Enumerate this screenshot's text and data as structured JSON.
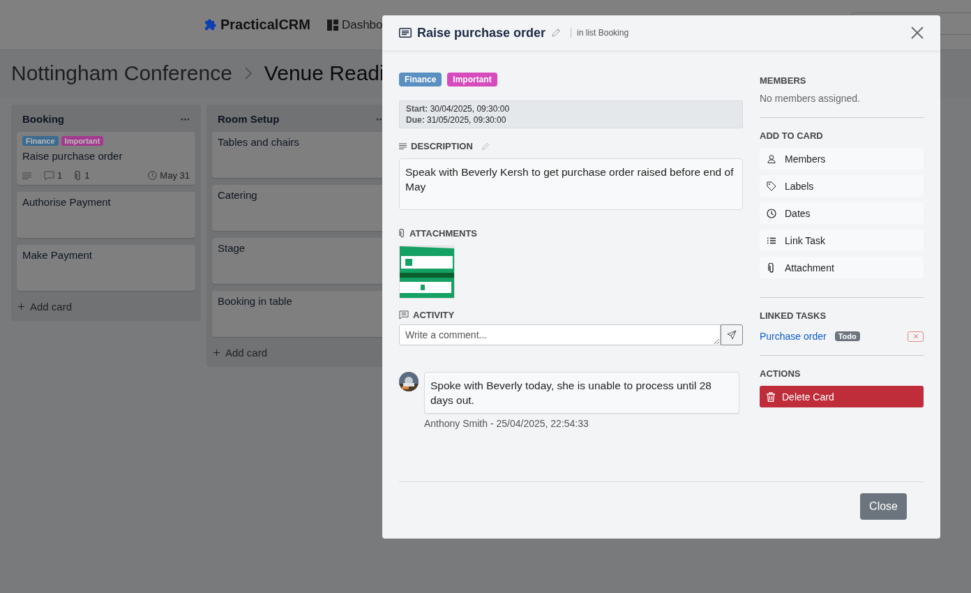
{
  "header": {
    "brand": "PracticalCRM",
    "nav": [
      {
        "label": "Dashbo"
      }
    ]
  },
  "breadcrumb": [
    "Nottingham Conference",
    "Venue Readi"
  ],
  "columns": [
    {
      "title": "Booking",
      "cards": [
        {
          "title": "Raise purchase order",
          "labels": [
            {
              "text": "Finance",
              "color": "#3d6b8f"
            },
            {
              "text": "Important",
              "color": "#a33a8f"
            }
          ],
          "has_description": true,
          "comments": "1",
          "attachments": "1",
          "due": "May 31"
        },
        {
          "title": "Authorise Payment"
        },
        {
          "title": "Make Payment"
        }
      ],
      "add": "Add card"
    },
    {
      "title": "Room Setup",
      "cards": [
        {
          "title": "Tables and chairs"
        },
        {
          "title": "Catering"
        },
        {
          "title": "Stage"
        },
        {
          "title": "Booking in table"
        }
      ],
      "add": "Add card"
    }
  ],
  "modal": {
    "title": "Raise purchase order",
    "list_info": "in list Booking",
    "labels": [
      {
        "text": "Finance",
        "color": "#5a8fc1"
      },
      {
        "text": "Important",
        "color": "#d84bbd"
      }
    ],
    "dates": [
      {
        "label": "Start:",
        "value": "30/04/2025, 09:30:00"
      },
      {
        "label": "Due:",
        "value": "31/05/2025, 09:30:00"
      }
    ],
    "description_heading": "DESCRIPTION",
    "description": "Speak with Beverly Kersh to get purchase order raised before end of May",
    "attachments_heading": "ATTACHMENTS",
    "activity_heading": "ACTIVITY",
    "comment_placeholder": "Write a comment...",
    "comments": [
      {
        "text": "Spoke with Beverly today, she is unable to process until 28 days out.",
        "meta": "Anthony Smith - 25/04/2025, 22:54:33"
      }
    ],
    "members_heading": "MEMBERS",
    "members_empty": "No members assigned.",
    "add_heading": "ADD TO CARD",
    "add_items": [
      {
        "kind": "members",
        "label": "Members"
      },
      {
        "kind": "labels",
        "label": "Labels"
      },
      {
        "kind": "dates",
        "label": "Dates"
      },
      {
        "kind": "link",
        "label": "Link Task"
      },
      {
        "kind": "attachment",
        "label": "Attachment"
      }
    ],
    "linked_heading": "LINKED TASKS",
    "linked_tasks": [
      {
        "title": "Purchase order",
        "status": "Todo"
      }
    ],
    "actions_heading": "ACTIONS",
    "delete_label": "Delete Card",
    "close_label": "Close"
  }
}
